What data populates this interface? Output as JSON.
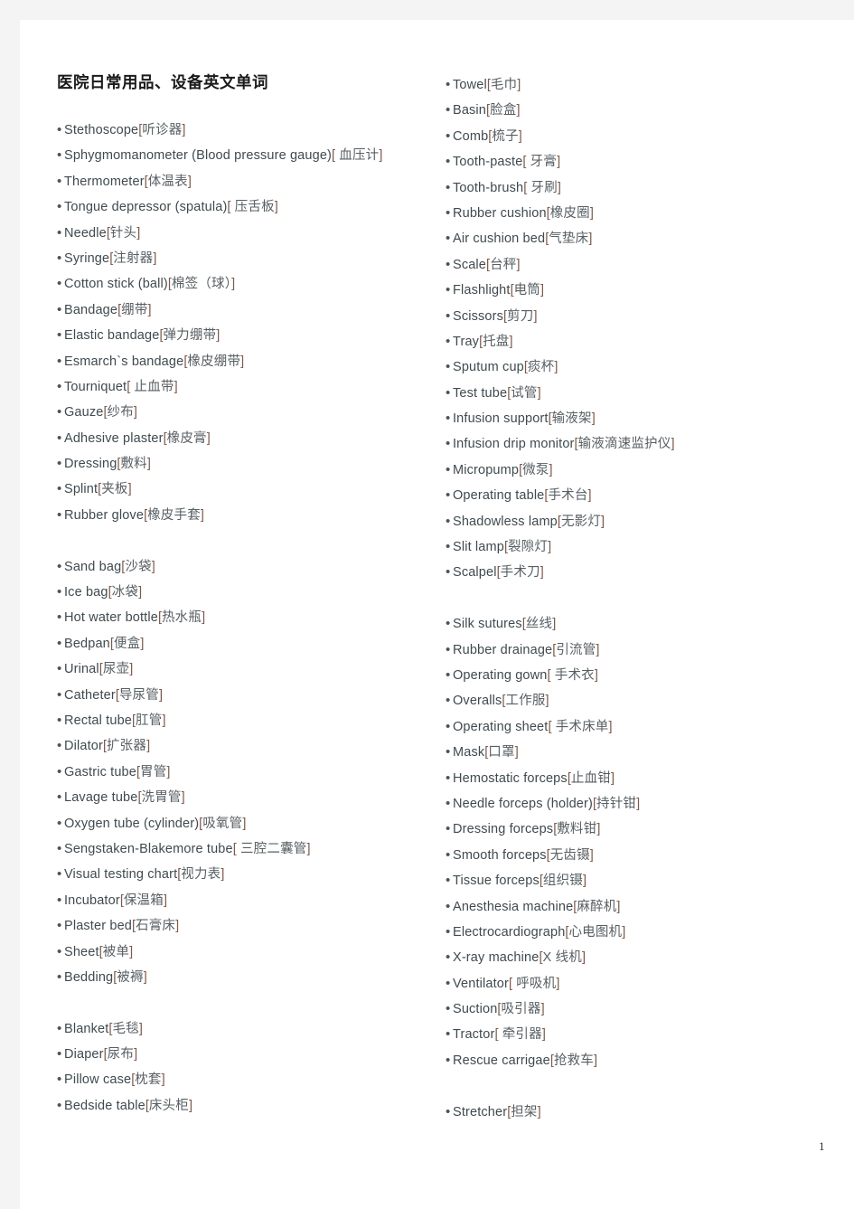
{
  "document": {
    "title": "医院日常用品、设备英文单词",
    "page_number": "1",
    "colors": {
      "english_text": "#3f4a4f",
      "chinese_text": "#585f63",
      "bracket": "#7d5a4a",
      "page_background": "#ffffff",
      "gutter": "#f4f4f4"
    }
  },
  "columns": {
    "left": {
      "groups": [
        {
          "items": [
            {
              "en": "Stethoscope",
              "zh": "听诊器"
            },
            {
              "en": "Sphygmomanometer  (Blood  pressure  gauge)",
              "zh": " 血压计"
            },
            {
              "en": "Thermometer",
              "zh": "体温表"
            },
            {
              "en": "Tongue  depressor  (spatula)",
              "zh": " 压舌板"
            },
            {
              "en": "Needle",
              "zh": "针头"
            },
            {
              "en": "Syringe",
              "zh": "注射器"
            },
            {
              "en": "Cotton  stick  (ball)",
              "zh": "棉签（球）"
            },
            {
              "en": "Bandage",
              "zh": "绷带"
            },
            {
              "en": "Elastic  bandage",
              "zh": "弹力绷带"
            },
            {
              "en": "Esmarch`s  bandage",
              "zh": "橡皮绷带"
            },
            {
              "en": "Tourniquet",
              "zh": " 止血带"
            },
            {
              "en": "Gauze",
              "zh": "纱布"
            },
            {
              "en": "Adhesive  plaster",
              "zh": "橡皮膏"
            },
            {
              "en": "Dressing",
              "zh": "敷料"
            },
            {
              "en": "Splint",
              "zh": "夹板"
            },
            {
              "en": "Rubber  glove",
              "zh": "橡皮手套"
            }
          ]
        },
        {
          "items": [
            {
              "en": "Sand  bag",
              "zh": "沙袋"
            },
            {
              "en": "Ice  bag",
              "zh": "冰袋"
            },
            {
              "en": "Hot  water  bottle",
              "zh": "热水瓶"
            },
            {
              "en": "Bedpan",
              "zh": "便盒"
            },
            {
              "en": "Urinal",
              "zh": "尿壶"
            },
            {
              "en": "Catheter",
              "zh": "导尿管"
            },
            {
              "en": "Rectal  tube",
              "zh": "肛管"
            },
            {
              "en": "Dilator",
              "zh": "扩张器"
            },
            {
              "en": "Gastric  tube",
              "zh": "胃管"
            },
            {
              "en": "Lavage  tube",
              "zh": "洗胃管"
            },
            {
              "en": "Oxygen  tube  (cylinder)",
              "zh": "吸氧管"
            },
            {
              "en": "Sengstaken-Blakemore  tube",
              "zh": " 三腔二囊管"
            },
            {
              "en": "Visual  testing  chart",
              "zh": "视力表"
            },
            {
              "en": "Incubator",
              "zh": "保温箱"
            },
            {
              "en": "Plaster  bed",
              "zh": "石膏床"
            },
            {
              "en": "Sheet",
              "zh": "被单"
            },
            {
              "en": "Bedding",
              "zh": "被褥"
            }
          ]
        },
        {
          "items": [
            {
              "en": "Blanket",
              "zh": "毛毯"
            },
            {
              "en": "Diaper",
              "zh": "尿布"
            },
            {
              "en": "Pillow  case",
              "zh": "枕套"
            },
            {
              "en": "Bedside  table",
              "zh": "床头柜"
            }
          ]
        }
      ]
    },
    "right": {
      "groups": [
        {
          "items": [
            {
              "en": "Towel",
              "zh": "毛巾"
            },
            {
              "en": "Basin",
              "zh": "脸盒"
            },
            {
              "en": "Comb",
              "zh": "梳子"
            },
            {
              "en": "Tooth-paste",
              "zh": " 牙膏"
            },
            {
              "en": "Tooth-brush",
              "zh": " 牙刷"
            },
            {
              "en": "Rubber  cushion",
              "zh": "橡皮圈"
            },
            {
              "en": "Air  cushion  bed",
              "zh": "气垫床"
            },
            {
              "en": "Scale",
              "zh": "台秤"
            },
            {
              "en": "Flashlight",
              "zh": "电筒"
            },
            {
              "en": "Scissors",
              "zh": "剪刀"
            },
            {
              "en": "Tray",
              "zh": "托盘"
            },
            {
              "en": "Sputum  cup",
              "zh": "痰杯"
            },
            {
              "en": "Test  tube",
              "zh": "试管"
            },
            {
              "en": "Infusion  support",
              "zh": "输液架"
            },
            {
              "en": "Infusion  drip  monitor",
              "zh": "输液滴速监护仪"
            },
            {
              "en": "Micropump",
              "zh": "微泵"
            },
            {
              "en": "Operating  table",
              "zh": "手术台"
            },
            {
              "en": "Shadowless  lamp",
              "zh": "无影灯"
            },
            {
              "en": "Slit  lamp",
              "zh": "裂隙灯"
            },
            {
              "en": "Scalpel",
              "zh": "手术刀"
            }
          ]
        },
        {
          "items": [
            {
              "en": "Silk  sutures",
              "zh": "丝线"
            },
            {
              "en": "Rubber  drainage",
              "zh": "引流管"
            },
            {
              "en": "Operating  gown",
              "zh": " 手术衣"
            },
            {
              "en": "Overalls",
              "zh": "工作服"
            },
            {
              "en": "Operating  sheet",
              "zh": " 手术床单"
            },
            {
              "en": "Mask",
              "zh": "口罩"
            },
            {
              "en": "Hemostatic  forceps",
              "zh": "止血钳"
            },
            {
              "en": "Needle  forceps  (holder)",
              "zh": "持针钳"
            },
            {
              "en": "Dressing  forceps",
              "zh": "敷料钳"
            },
            {
              "en": "Smooth  forceps",
              "zh": "无齿镊"
            },
            {
              "en": "Tissue  forceps",
              "zh": "组织镊"
            },
            {
              "en": "Anesthesia  machine",
              "zh": "麻醉机"
            },
            {
              "en": "Electrocardiograph",
              "zh": "心电图机"
            },
            {
              "en": "X-ray  machine",
              "zh": "X 线机"
            },
            {
              "en": "Ventilator",
              "zh": " 呼吸机"
            },
            {
              "en": "Suction",
              "zh": "吸引器"
            },
            {
              "en": "Tractor",
              "zh": " 牵引器"
            },
            {
              "en": "Rescue  carrigae",
              "zh": "抢救车"
            }
          ]
        },
        {
          "items": [
            {
              "en": "Stretcher",
              "zh": "担架"
            }
          ]
        }
      ]
    }
  }
}
